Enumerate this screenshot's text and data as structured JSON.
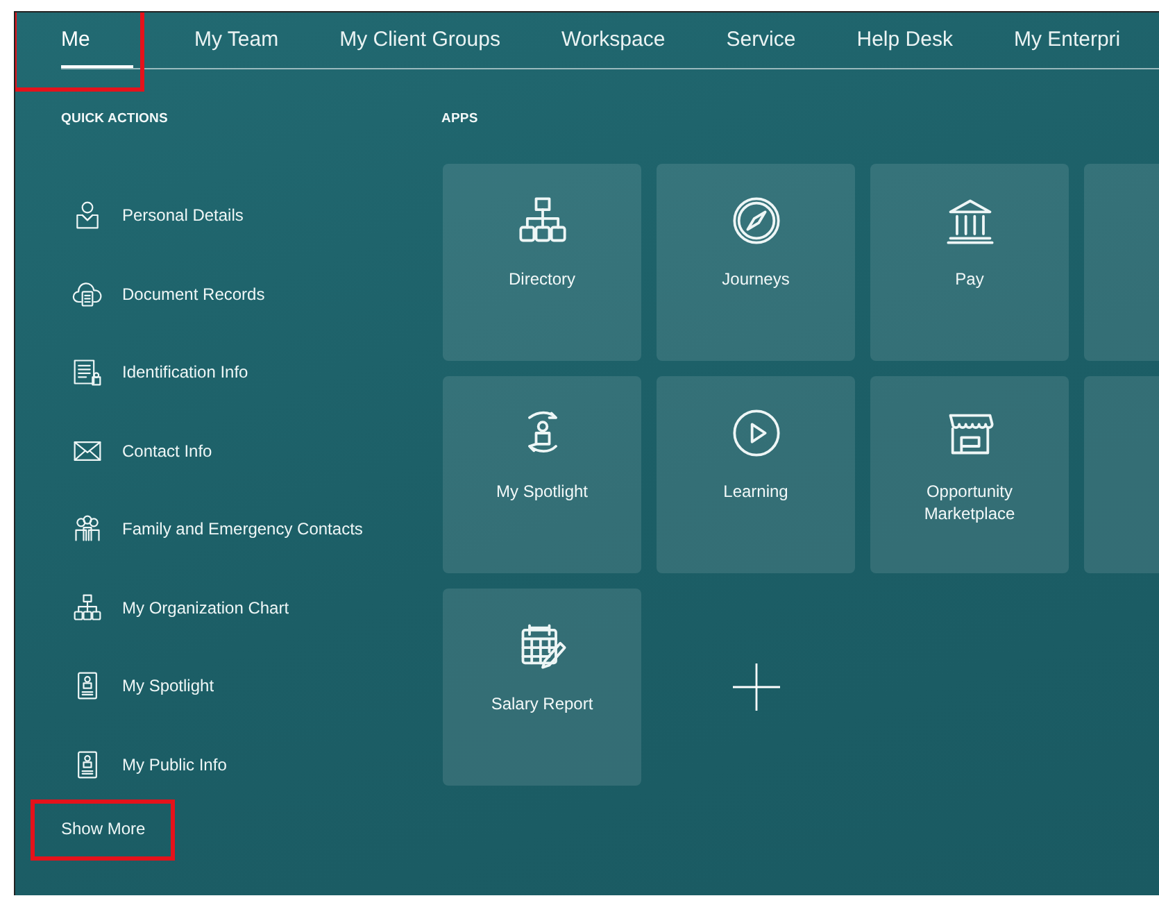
{
  "nav_tabs": [
    {
      "label": "Me",
      "selected": true,
      "highlighted": true
    },
    {
      "label": "My Team",
      "selected": false,
      "highlighted": false
    },
    {
      "label": "My Client Groups",
      "selected": false,
      "highlighted": false
    },
    {
      "label": "Workspace",
      "selected": false,
      "highlighted": false
    },
    {
      "label": "Service",
      "selected": false,
      "highlighted": false
    },
    {
      "label": "Help Desk",
      "selected": false,
      "highlighted": false
    },
    {
      "label": "My Enterpri",
      "selected": false,
      "highlighted": false
    }
  ],
  "quick_actions": {
    "title": "QUICK ACTIONS",
    "items": [
      {
        "label": "Personal Details"
      },
      {
        "label": "Document Records"
      },
      {
        "label": "Identification Info"
      },
      {
        "label": "Contact Info"
      },
      {
        "label": "Family and Emergency Contacts"
      },
      {
        "label": "My Organization Chart"
      },
      {
        "label": "My Spotlight"
      },
      {
        "label": "My Public Info"
      }
    ],
    "show_more": {
      "label": "Show More",
      "highlighted": true
    }
  },
  "apps": {
    "title": "APPS",
    "tiles": [
      {
        "kind": "app",
        "label": "Directory"
      },
      {
        "kind": "app",
        "label": "Journeys"
      },
      {
        "kind": "app",
        "label": "Pay"
      },
      {
        "kind": "partial"
      },
      {
        "kind": "app",
        "label": "My Spotlight"
      },
      {
        "kind": "app",
        "label": "Learning"
      },
      {
        "kind": "app",
        "label": "Opportunity Marketplace"
      },
      {
        "kind": "partial"
      },
      {
        "kind": "app",
        "label": "Salary Report"
      },
      {
        "kind": "add"
      }
    ]
  }
}
